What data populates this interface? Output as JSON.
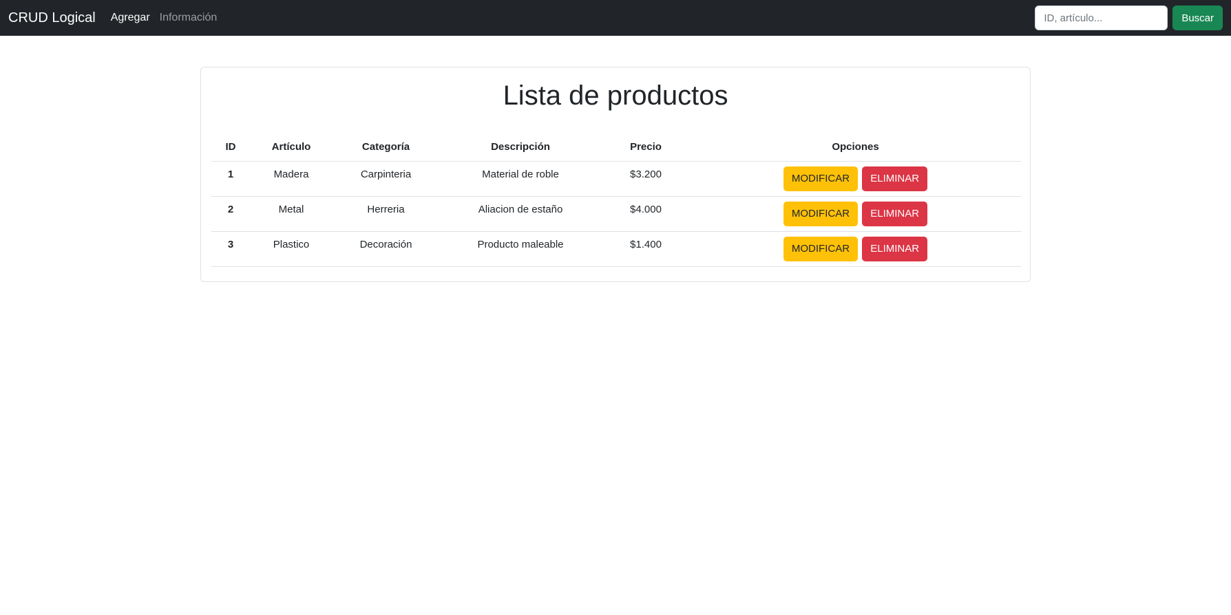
{
  "navbar": {
    "brand": "CRUD Logical",
    "links": [
      {
        "label": "Agregar",
        "active": true
      },
      {
        "label": "Información",
        "active": false
      }
    ],
    "search": {
      "placeholder": "ID, artículo...",
      "value": "",
      "button_label": "Buscar"
    }
  },
  "main": {
    "title": "Lista de productos",
    "table": {
      "headers": [
        "ID",
        "Artículo",
        "Categoría",
        "Descripción",
        "Precio",
        "Opciones"
      ],
      "rows": [
        {
          "id": "1",
          "articulo": "Madera",
          "categoria": "Carpinteria",
          "descripcion": "Material de roble",
          "precio": "$3.200"
        },
        {
          "id": "2",
          "articulo": "Metal",
          "categoria": "Herreria",
          "descripcion": "Aliacion de estaño",
          "precio": "$4.000"
        },
        {
          "id": "3",
          "articulo": "Plastico",
          "categoria": "Decoración",
          "descripcion": "Producto maleable",
          "precio": "$1.400"
        }
      ],
      "modify_label": "MODIFICAR",
      "delete_label": "ELIMINAR"
    }
  },
  "colors": {
    "navbar_bg": "#212529",
    "success": "#198754",
    "warning": "#ffc107",
    "danger": "#dc3545"
  }
}
